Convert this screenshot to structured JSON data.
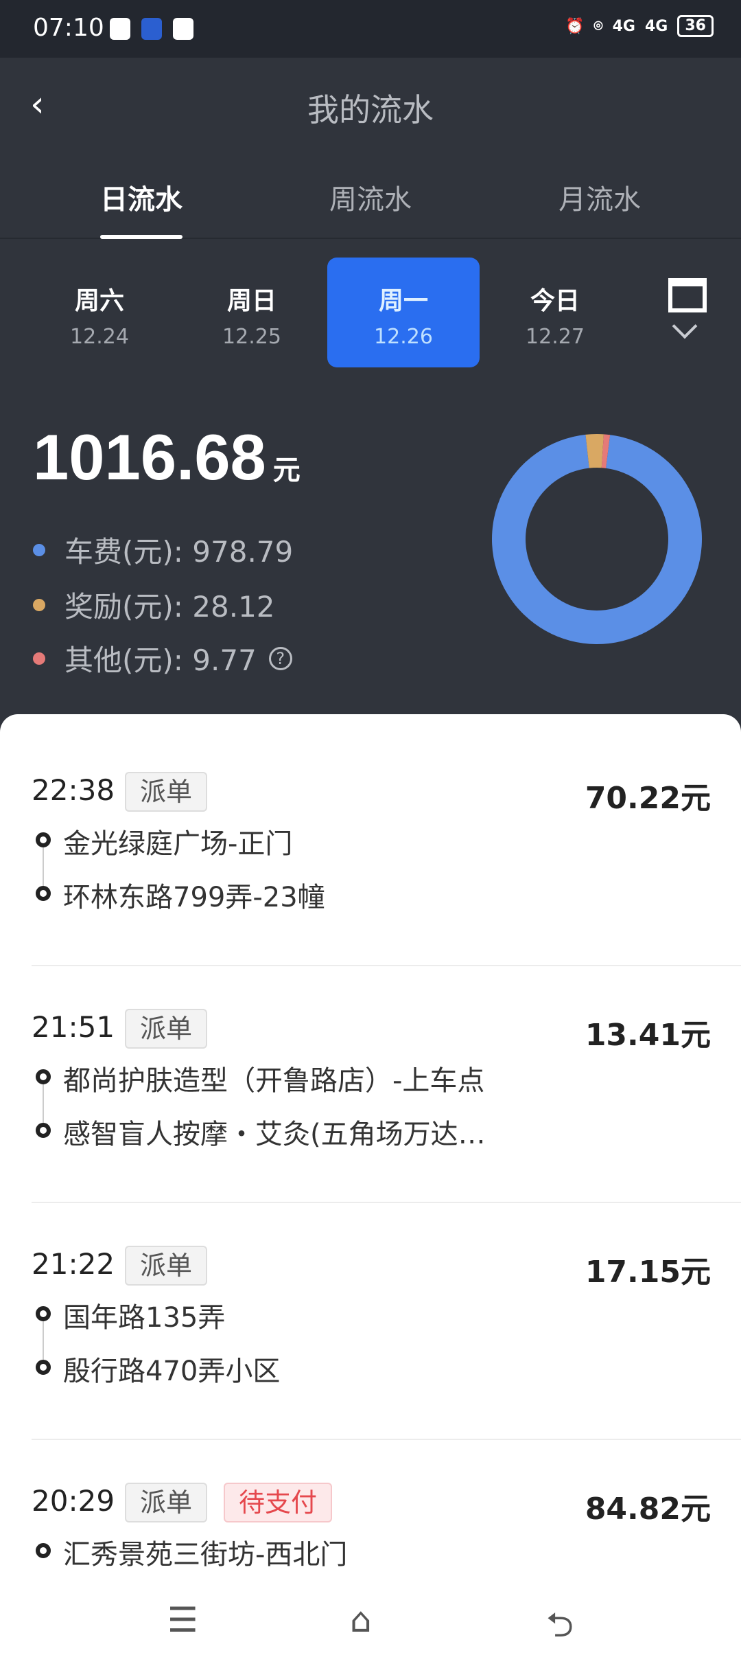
{
  "status": {
    "time": "07:10",
    "battery": "36",
    "network": "4G"
  },
  "header": {
    "title": "我的流水",
    "back": "‹"
  },
  "tabs": [
    {
      "label": "日流水",
      "active": true
    },
    {
      "label": "周流水"
    },
    {
      "label": "月流水"
    }
  ],
  "days": [
    {
      "week": "周六",
      "date": "12.24"
    },
    {
      "week": "周日",
      "date": "12.25"
    },
    {
      "week": "周一",
      "date": "12.26",
      "selected": true
    },
    {
      "week": "今日",
      "date": "12.27"
    }
  ],
  "summary": {
    "total": "1016.68",
    "unit": "元",
    "legend": [
      {
        "label": "车费(元): 978.79",
        "color": "#5b8fe6"
      },
      {
        "label": "奖励(元): 28.12",
        "color": "#d9a863"
      },
      {
        "label": "其他(元): 9.77",
        "color": "#e57a78"
      }
    ],
    "help": "?"
  },
  "chart_data": {
    "type": "pie",
    "donut": true,
    "values": [
      978.79,
      28.12,
      9.77
    ],
    "colors": [
      "#5b8fe6",
      "#d9a863",
      "#e57a78"
    ]
  },
  "orders": [
    {
      "time": "22:38",
      "badges": [
        "派单"
      ],
      "amount": "70.22元",
      "from": "金光绿庭广场-正门",
      "to": "环林东路799弄-23幢"
    },
    {
      "time": "21:51",
      "badges": [
        "派单"
      ],
      "amount": "13.41元",
      "from": "都尚护肤造型（开鲁路店）-上车点",
      "to": "感智盲人按摩・艾灸(五角场万达…"
    },
    {
      "time": "21:22",
      "badges": [
        "派单"
      ],
      "amount": "17.15元",
      "from": "国年路135弄",
      "to": "殷行路470弄小区"
    },
    {
      "time": "20:29",
      "badges": [
        "派单",
        "待支付"
      ],
      "amount": "84.82元",
      "from": "汇秀景苑三街坊-西北门",
      "to": ""
    }
  ],
  "nav": {
    "menu": "☰",
    "home": "⌂",
    "back": "⮌"
  }
}
